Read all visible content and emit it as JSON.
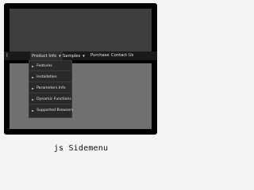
{
  "menubar": {
    "items": [
      {
        "label": "Product Info",
        "has_arrow": true,
        "arrow": "▼"
      },
      {
        "label": "Samples",
        "has_arrow": true,
        "arrow": "▼"
      },
      {
        "label": "Purchase",
        "has_arrow": false
      },
      {
        "label": "Contact Us",
        "has_arrow": false
      }
    ],
    "pipe": "|"
  },
  "submenu": {
    "bullet": "►",
    "items": [
      {
        "label": "Features"
      },
      {
        "label": "Installation"
      },
      {
        "label": "Parameters Info"
      },
      {
        "label": "Dynamic Functions"
      },
      {
        "label": "Supported Browsers"
      }
    ]
  },
  "caption": "js Sidemenu",
  "colors": {
    "frame": "#000000",
    "header_area": "#3e3e3e",
    "content_area": "#707070",
    "menubar": "#1a1a1a",
    "submenu": "#2a2a2a",
    "background": "#f4f4f4"
  }
}
